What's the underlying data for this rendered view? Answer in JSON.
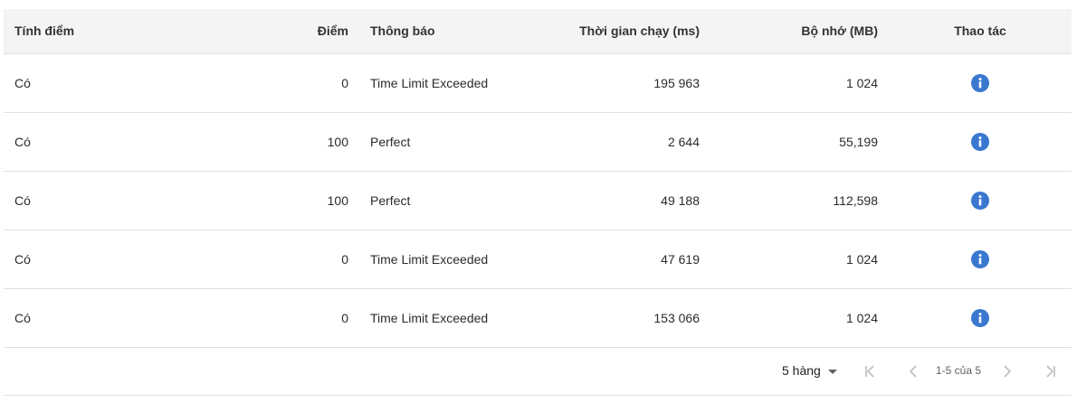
{
  "columns": {
    "scored": "Tính điểm",
    "score": "Điểm",
    "message": "Thông báo",
    "runtime": "Thời gian chạy (ms)",
    "memory": "Bộ nhớ (MB)",
    "actions": "Thao tác"
  },
  "rows": [
    {
      "scored": "Có",
      "score": "0",
      "message": "Time Limit Exceeded",
      "runtime": "195 963",
      "memory": "1 024"
    },
    {
      "scored": "Có",
      "score": "100",
      "message": "Perfect",
      "runtime": "2 644",
      "memory": "55,199"
    },
    {
      "scored": "Có",
      "score": "100",
      "message": "Perfect",
      "runtime": "49 188",
      "memory": "112,598"
    },
    {
      "scored": "Có",
      "score": "0",
      "message": "Time Limit Exceeded",
      "runtime": "47 619",
      "memory": "1 024"
    },
    {
      "scored": "Có",
      "score": "0",
      "message": "Time Limit Exceeded",
      "runtime": "153 066",
      "memory": "1 024"
    }
  ],
  "action_icon": "info-icon",
  "colors": {
    "info": "#3a78d0",
    "header_bg": "#f4f4f4",
    "pager_enabled": "#616161",
    "pager_disabled": "#bdbdbd"
  },
  "pagination": {
    "rows_per_page": "5 hàng",
    "range": "1-5 của 5",
    "first_icon": "first-page-icon",
    "prev_icon": "chevron-left-icon",
    "next_icon": "chevron-right-icon",
    "last_icon": "last-page-icon"
  }
}
